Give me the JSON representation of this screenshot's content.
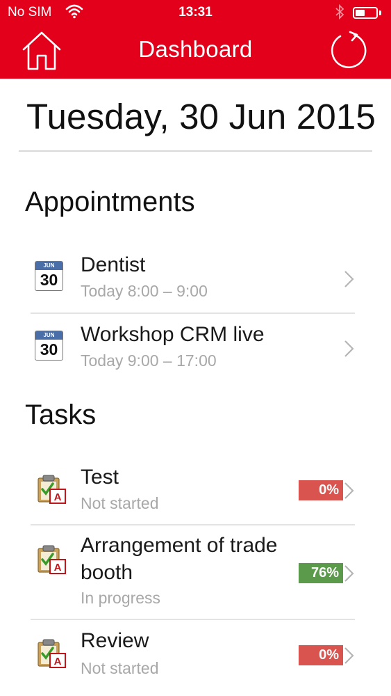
{
  "status_bar": {
    "carrier": "No SIM",
    "time": "13:31",
    "icons": [
      "wifi-icon",
      "bluetooth-icon",
      "battery-icon"
    ]
  },
  "nav": {
    "title": "Dashboard",
    "left_icon": "home-icon",
    "right_icon": "refresh-icon"
  },
  "date": "Tuesday, 30 Jun 2015",
  "appointments": {
    "title": "Appointments",
    "items": [
      {
        "title": "Dentist",
        "time": "Today 8:00 – 9:00",
        "icon": {
          "month": "JUN",
          "day": "30"
        }
      },
      {
        "title": "Workshop CRM live",
        "time": "Today 9:00 – 17:00",
        "icon": {
          "month": "JUN",
          "day": "30"
        }
      }
    ]
  },
  "tasks": {
    "title": "Tasks",
    "items": [
      {
        "title": "Test",
        "status": "Not started",
        "progress": "0%",
        "progress_value": 0,
        "color": "#d9534f"
      },
      {
        "title_line1": "Arrangement of trade",
        "title_line2": "booth",
        "status": "In progress",
        "progress": "76%",
        "progress_value": 76,
        "color": "#5a9a4a"
      },
      {
        "title": "Review",
        "status": "Not started",
        "progress": "0%",
        "progress_value": 0,
        "color": "#d9534f"
      }
    ]
  },
  "colors": {
    "brand": "#e3001b",
    "badge_not_started": "#d9534f",
    "badge_in_progress": "#5a9a4a"
  }
}
